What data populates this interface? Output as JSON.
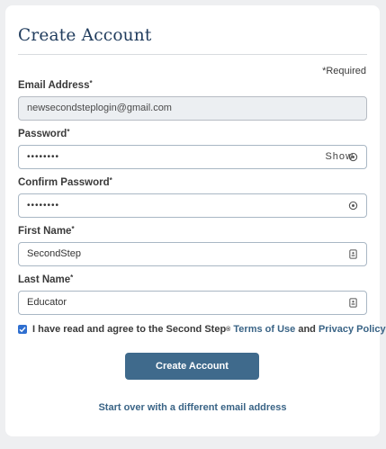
{
  "title": "Create Account",
  "required_note": "*Required",
  "fields": {
    "email": {
      "label": "Email Address",
      "required": "*",
      "value": "newsecondsteplogin@gmail.com"
    },
    "password": {
      "label": "Password",
      "required": "*",
      "value": "••••••••",
      "toggle": "Show"
    },
    "confirm_password": {
      "label": "Confirm Password",
      "required": "*",
      "value": "••••••••"
    },
    "first_name": {
      "label": "First Name",
      "required": "*",
      "value": "SecondStep"
    },
    "last_name": {
      "label": "Last Name",
      "required": "*",
      "value": "Educator"
    }
  },
  "agreement": {
    "checked": true,
    "text_before": "I have read and agree to the Second Step",
    "registered": "®",
    "terms_link": "Terms of Use",
    "and_text": "and",
    "privacy_link": "Privacy Policy"
  },
  "submit_label": "Create Account",
  "start_over_link": "Start over with a different email address",
  "colors": {
    "accent": "#3f6a8c",
    "title": "#1f3b5c",
    "link": "#3a6486",
    "checkbox": "#2f6fd0"
  },
  "icons": {
    "password": "eye-icon",
    "confirm_password": "eye-icon",
    "first_name": "contact-card-icon",
    "last_name": "contact-card-icon",
    "checkbox": "checkmark-icon"
  }
}
